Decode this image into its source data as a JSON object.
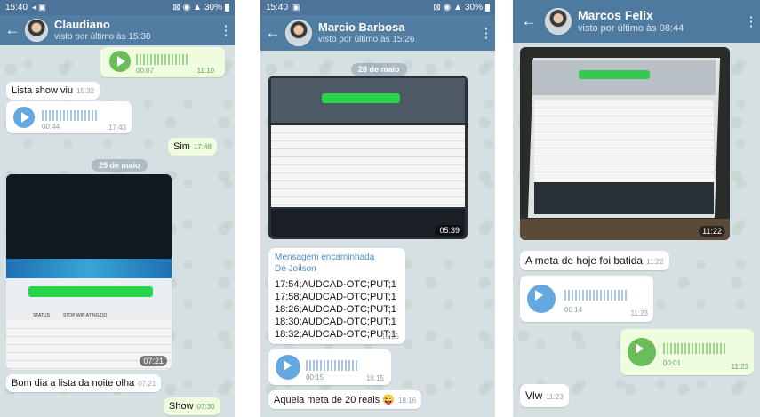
{
  "phones": [
    {
      "status": {
        "time": "15:40",
        "battery": "30%"
      },
      "header": {
        "name": "Claudiano",
        "seen": "visto por último às 15:38"
      },
      "messages": {
        "voice_top": {
          "duration": "00:07",
          "time": "11:10"
        },
        "lista": {
          "text": "Lista show viu",
          "time": "15:32"
        },
        "voice_in": {
          "duration": "00:44",
          "time": "17:43"
        },
        "sim": {
          "text": "Sim",
          "time": "17:48"
        },
        "date": "25 de maio",
        "image": {
          "time": "07:21",
          "screen_button": "STOP WIN ATINGIDO",
          "status_label": "STATUS"
        },
        "bom_dia": {
          "text": "Bom dia a lista da noite olha",
          "time": "07:21"
        },
        "show": {
          "text": "Show",
          "time": "07:30"
        }
      }
    },
    {
      "status": {
        "time": "15:40",
        "battery": "30%"
      },
      "header": {
        "name": "Marcio Barbosa",
        "seen": "visto por último às 15:26"
      },
      "messages": {
        "date": "28 de maio",
        "image": {
          "time": "05:39"
        },
        "forward": {
          "title": "Mensagem encaminhada",
          "from": "De Joilson",
          "lines": [
            "17:54;AUDCAD-OTC;PUT;1",
            "17:58;AUDCAD-OTC;PUT;1",
            "18:26;AUDCAD-OTC;PUT;1",
            "18:30;AUDCAD-OTC;PUT;1",
            "18:32;AUDCAD-OTC;PUT;1"
          ],
          "time": "18:15"
        },
        "voice": {
          "duration": "00:15",
          "time": "18:15"
        },
        "meta": {
          "text": "Aquela meta de 20 reais 😜",
          "time": "18:16"
        }
      }
    },
    {
      "header": {
        "name": "Marcos Felix",
        "seen": "visto por último às 08:44"
      },
      "messages": {
        "image": {
          "time": "11:22"
        },
        "meta_hoje": {
          "text": "A meta de hoje foi batida",
          "time": "11:22"
        },
        "voice_in": {
          "duration": "00:14",
          "time": "11:23"
        },
        "voice_out": {
          "duration": "00:01",
          "time": "11:23"
        },
        "vlw": {
          "text": "Vlw",
          "time": "11:23"
        }
      }
    }
  ],
  "colors": {
    "header": "#527da3",
    "statusbar": "#4d7399",
    "outgoing": "#effdde",
    "accent_blue": "#65a8df",
    "accent_green": "#6bbd5b"
  }
}
